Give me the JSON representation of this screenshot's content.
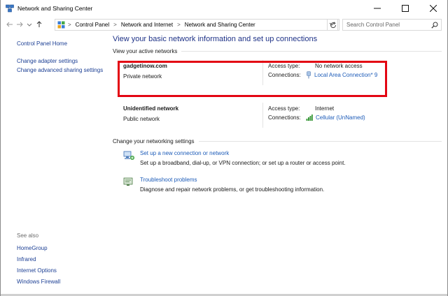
{
  "window": {
    "title": "Network and Sharing Center",
    "minimize_glyph": "—",
    "maximize_glyph": "☐",
    "close_glyph": "✕"
  },
  "address": {
    "breadcrumbs": [
      "Control Panel",
      "Network and Internet",
      "Network and Sharing Center"
    ],
    "separator": ">",
    "search_placeholder": "Search Control Panel"
  },
  "sidebar": {
    "home": "Control Panel Home",
    "links": [
      "Change adapter settings",
      "Change advanced sharing settings"
    ],
    "see_also_title": "See also",
    "see_also": [
      "HomeGroup",
      "Infrared",
      "Internet Options",
      "Windows Firewall"
    ]
  },
  "main": {
    "heading": "View your basic network information and set up connections",
    "active_networks_label": "View your active networks",
    "networks": [
      {
        "name": "gadgetinow.com",
        "type": "Private network",
        "access_label": "Access type:",
        "access_value": "No network access",
        "connections_label": "Connections:",
        "connection": "Local Area Connection* 9",
        "connection_icon": "ethernet-icon"
      },
      {
        "name": "Unidentified network",
        "type": "Public network",
        "access_label": "Access type:",
        "access_value": "Internet",
        "connections_label": "Connections:",
        "connection": "Cellular (UnNamed)",
        "connection_icon": "signal-bars-icon"
      }
    ],
    "change_settings_label": "Change your networking settings",
    "tasks": [
      {
        "link": "Set up a new connection or network",
        "description": "Set up a broadband, dial-up, or VPN connection; or set up a router or access point.",
        "icon": "new-connection-icon"
      },
      {
        "link": "Troubleshoot problems",
        "description": "Diagnose and repair network problems, or get troubleshooting information.",
        "icon": "troubleshoot-icon"
      }
    ]
  },
  "colors": {
    "link": "#1c5bb8",
    "heading": "#1e3287",
    "highlight_border": "#e30613"
  }
}
